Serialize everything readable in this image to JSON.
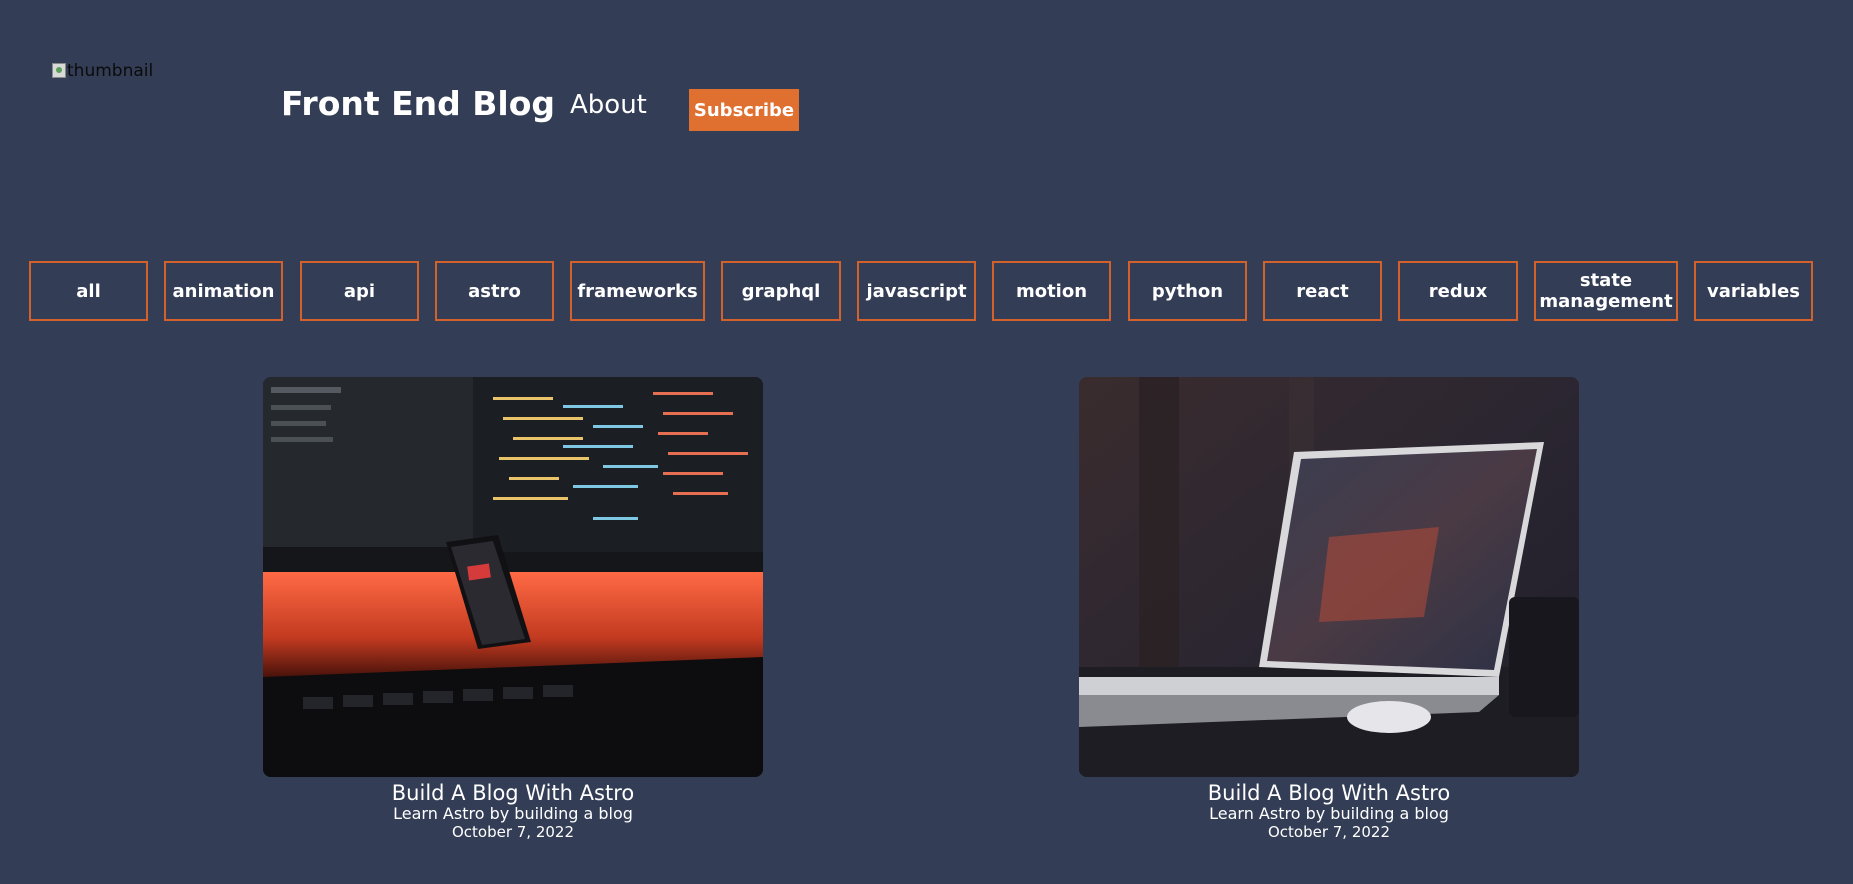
{
  "header": {
    "logo_alt": "thumbnail",
    "title": "Front End Blog",
    "nav_about": "About",
    "subscribe_label": "Subscribe"
  },
  "tags": [
    "all",
    "animation",
    "api",
    "astro",
    "frameworks",
    "graphql",
    "javascript",
    "motion",
    "python",
    "react",
    "redux",
    "state management",
    "variables"
  ],
  "posts": [
    {
      "title": "Build A Blog With Astro",
      "description": "Learn Astro by building a blog",
      "date": "October 7, 2022"
    },
    {
      "title": "Build A Blog With Astro",
      "description": "Learn Astro by building a blog",
      "date": "October 7, 2022"
    }
  ],
  "colors": {
    "background": "#333d55",
    "accent": "#e07030",
    "tag_border": "#d2612b"
  }
}
